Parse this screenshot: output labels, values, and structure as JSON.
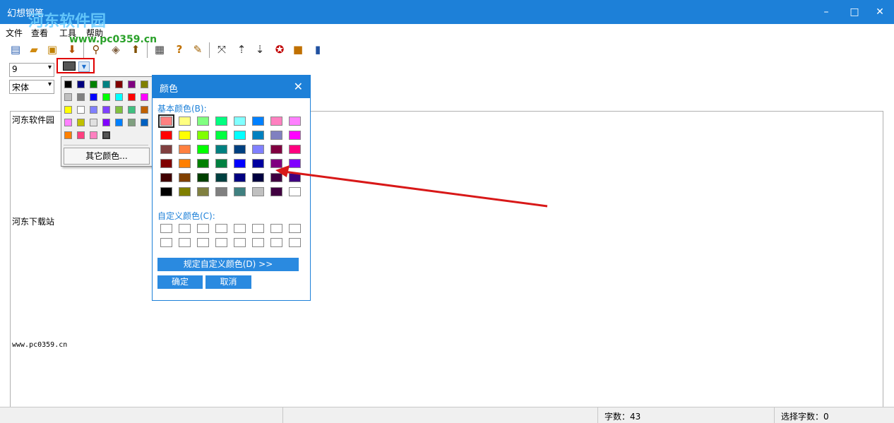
{
  "window": {
    "title": "幻想钢笔",
    "watermark": "河东软件园",
    "minimize": "–",
    "maximize": "□",
    "close": "✕"
  },
  "menu": {
    "items": [
      "文件",
      "查看",
      "工具",
      "帮助"
    ],
    "watermark_url": "www.pc0359.cn"
  },
  "toolbar": {
    "buttons": [
      "new-document",
      "open-folder",
      "save-disk",
      "save-as",
      "find",
      "package",
      "export",
      "calendar",
      "help-question",
      "settings-wrench",
      "fullscreen-arrows",
      "download-a",
      "download-b",
      "stop-badge",
      "lock",
      "chart-bars"
    ]
  },
  "format": {
    "font_size": "9",
    "font_name": "宋体",
    "color_accent": "#555555"
  },
  "editor": {
    "line1": "河东软件园",
    "line2": "河东下载站",
    "line3": "www.pc0359.cn"
  },
  "palette": {
    "colors": [
      "#000000",
      "#000080",
      "#008000",
      "#008080",
      "#800000",
      "#800080",
      "#808000",
      "#c0c0c0",
      "#808080",
      "#0000ff",
      "#00ff00",
      "#00ffff",
      "#ff0000",
      "#ff00ff",
      "#ffff00",
      "#ffffff",
      "#8080ff",
      "#8040ff",
      "#80c040",
      "#40c080",
      "#c06000",
      "#ff80ff",
      "#c0c000",
      "#e0e0e0",
      "#8000ff",
      "#0080ff",
      "#80a080",
      "#0060c0",
      "#ff8000",
      "#ff4080",
      "#ff80c0",
      "#555555"
    ],
    "more_colors": "其它颜色..."
  },
  "color_dialog": {
    "title": "颜色",
    "basic_label": "基本颜色(B):",
    "custom_label": "自定义颜色(C):",
    "define_custom": "规定自定义颜色(D) >>",
    "ok": "确定",
    "cancel": "取消",
    "basic_colors": [
      "#ff8080",
      "#ffff80",
      "#80ff80",
      "#00ff80",
      "#80ffff",
      "#0080ff",
      "#ff80c0",
      "#ff80ff",
      "#ff0000",
      "#ffff00",
      "#80ff00",
      "#00ff40",
      "#00ffff",
      "#0080c0",
      "#8080c0",
      "#ff00ff",
      "#804040",
      "#ff8040",
      "#00ff00",
      "#008080",
      "#004080",
      "#8080ff",
      "#800040",
      "#ff0080",
      "#800000",
      "#ff8000",
      "#008000",
      "#008040",
      "#0000ff",
      "#0000a0",
      "#800080",
      "#8000ff",
      "#400000",
      "#804000",
      "#004000",
      "#004040",
      "#000080",
      "#000040",
      "#400040",
      "#400080",
      "#000000",
      "#808000",
      "#808040",
      "#808080",
      "#408080",
      "#c0c0c0",
      "#400040",
      "#ffffff"
    ]
  },
  "status": {
    "word_count": "字数：43",
    "selected_count": "选择字数：0"
  }
}
